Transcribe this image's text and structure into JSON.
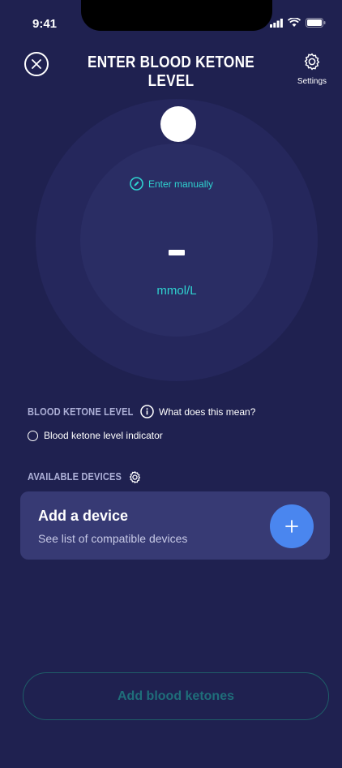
{
  "status_bar": {
    "time": "9:41"
  },
  "header": {
    "title": "ENTER BLOOD KETONE LEVEL",
    "settings_label": "Settings"
  },
  "gauge": {
    "enter_manually": "Enter manually",
    "unit": "mmol/L"
  },
  "info": {
    "blood_ketone_label": "BLOOD KETONE LEVEL",
    "what_link": "What does this mean?",
    "indicator_label": "Blood ketone level indicator",
    "devices_label": "AVAILABLE DEVICES"
  },
  "device_card": {
    "title": "Add a device",
    "subtitle": "See list of compatible devices"
  },
  "actions": {
    "add_button": "Add blood ketones"
  },
  "colors": {
    "background": "#1f2150",
    "accent_teal": "#2fd3d0",
    "plus_blue": "#4a86ef",
    "card": "#373a74"
  }
}
